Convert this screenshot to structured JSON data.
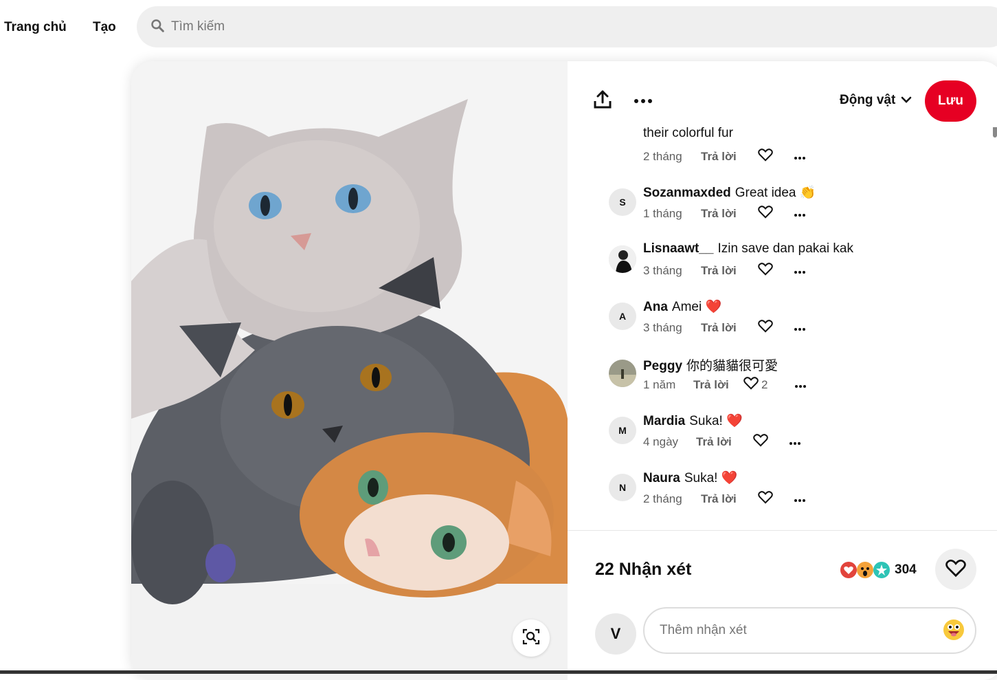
{
  "nav": {
    "home": "Trang chủ",
    "create": "Tạo"
  },
  "search": {
    "placeholder": "Tìm kiếm"
  },
  "actions": {
    "board": "Động vật",
    "save": "Lưu"
  },
  "partial_comment": {
    "text": "their colorful fur",
    "time": "2 tháng",
    "reply": "Trả lời"
  },
  "comments": [
    {
      "avatar": "S",
      "user": "Sozanmaxded",
      "text": "Great idea",
      "emoji": "👏",
      "time": "1 tháng",
      "reply": "Trả lời",
      "likes": ""
    },
    {
      "avatar": "photo",
      "user": "Lisnaawt__",
      "text": "Izin save dan pakai kak",
      "emoji": "",
      "time": "3 tháng",
      "reply": "Trả lời",
      "likes": ""
    },
    {
      "avatar": "A",
      "user": "Ana",
      "text": "Amei",
      "emoji": "❤️",
      "time": "3 tháng",
      "reply": "Trả lời",
      "likes": ""
    },
    {
      "avatar": "photo",
      "user": "Peggy",
      "text": "你的貓貓很可愛",
      "emoji": "",
      "time": "1 năm",
      "reply": "Trả lời",
      "likes": "2"
    },
    {
      "avatar": "M",
      "user": "Mardia",
      "text": "Suka!",
      "emoji": "❤️",
      "time": "4 ngày",
      "reply": "Trả lời",
      "likes": ""
    },
    {
      "avatar": "N",
      "user": "Naura",
      "text": "Suka!",
      "emoji": "❤️",
      "time": "2 tháng",
      "reply": "Trả lời",
      "likes": ""
    }
  ],
  "footer": {
    "count_label": "22 Nhận xét",
    "reactions_count": "304",
    "me_avatar": "V",
    "comment_placeholder": "Thêm nhận xét"
  },
  "colors": {
    "save": "#e60023",
    "heart": "#e60023"
  }
}
